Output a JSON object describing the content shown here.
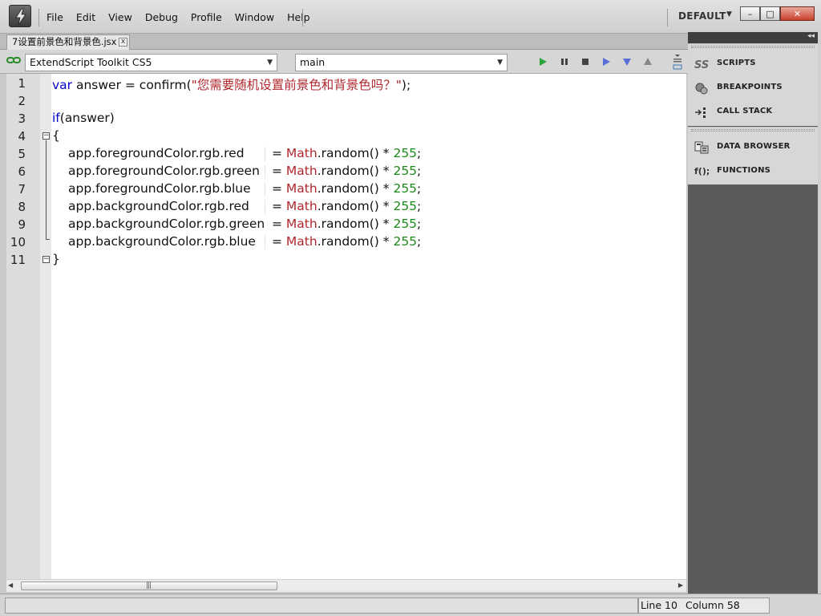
{
  "window": {
    "menu": [
      "File",
      "Edit",
      "View",
      "Debug",
      "Profile",
      "Window",
      "Help"
    ],
    "workspace": "DEFAULT",
    "controls": {
      "minimize": "–",
      "maximize": "□",
      "close": "✕"
    }
  },
  "document": {
    "tab_title": "7设置前景色和背景色.jsx",
    "tab_close": "x"
  },
  "toolbar": {
    "target_app": "ExtendScript Toolkit CS5",
    "engine": "main",
    "buttons": [
      "run",
      "pause",
      "stop",
      "step-over",
      "step-into",
      "step-out"
    ]
  },
  "editor": {
    "line_numbers": [
      "1",
      "2",
      "3",
      "4",
      "5",
      "6",
      "7",
      "8",
      "9",
      "10",
      "11"
    ],
    "code": {
      "l1_kw": "var",
      "l1_text": " answer = confirm(",
      "l1_str": "\"您需要随机设置前景色和背景色吗？\"",
      "l1_end": ");",
      "l3_kw": "if",
      "l3_text": "(answer)",
      "l4": "{",
      "l5_lhs": "app.foregroundColor.rgb.red",
      "l6_lhs": "app.foregroundColor.rgb.green",
      "l7_lhs": "app.foregroundColor.rgb.blue",
      "l8_lhs": "app.backgroundColor.rgb.red",
      "l9_lhs": "app.backgroundColor.rgb.green",
      "l10_lhs": "app.backgroundColor.rgb.blue",
      "assign": "= ",
      "math": "Math",
      "call": ".random() * ",
      "num": "255",
      "semi": ";",
      "l11": "}"
    }
  },
  "statusbar": {
    "line": "Line 10",
    "column": "Column 58"
  },
  "panels": {
    "group1": [
      "SCRIPTS",
      "BREAKPOINTS",
      "CALL STACK"
    ],
    "group2": [
      "DATA BROWSER",
      "FUNCTIONS"
    ],
    "functions_icon_text": "f();"
  },
  "colors": {
    "keyword": "#0000cc",
    "string": "#b0282d",
    "number": "#1a8a1a",
    "panel_bg": "#5b5b5b"
  }
}
